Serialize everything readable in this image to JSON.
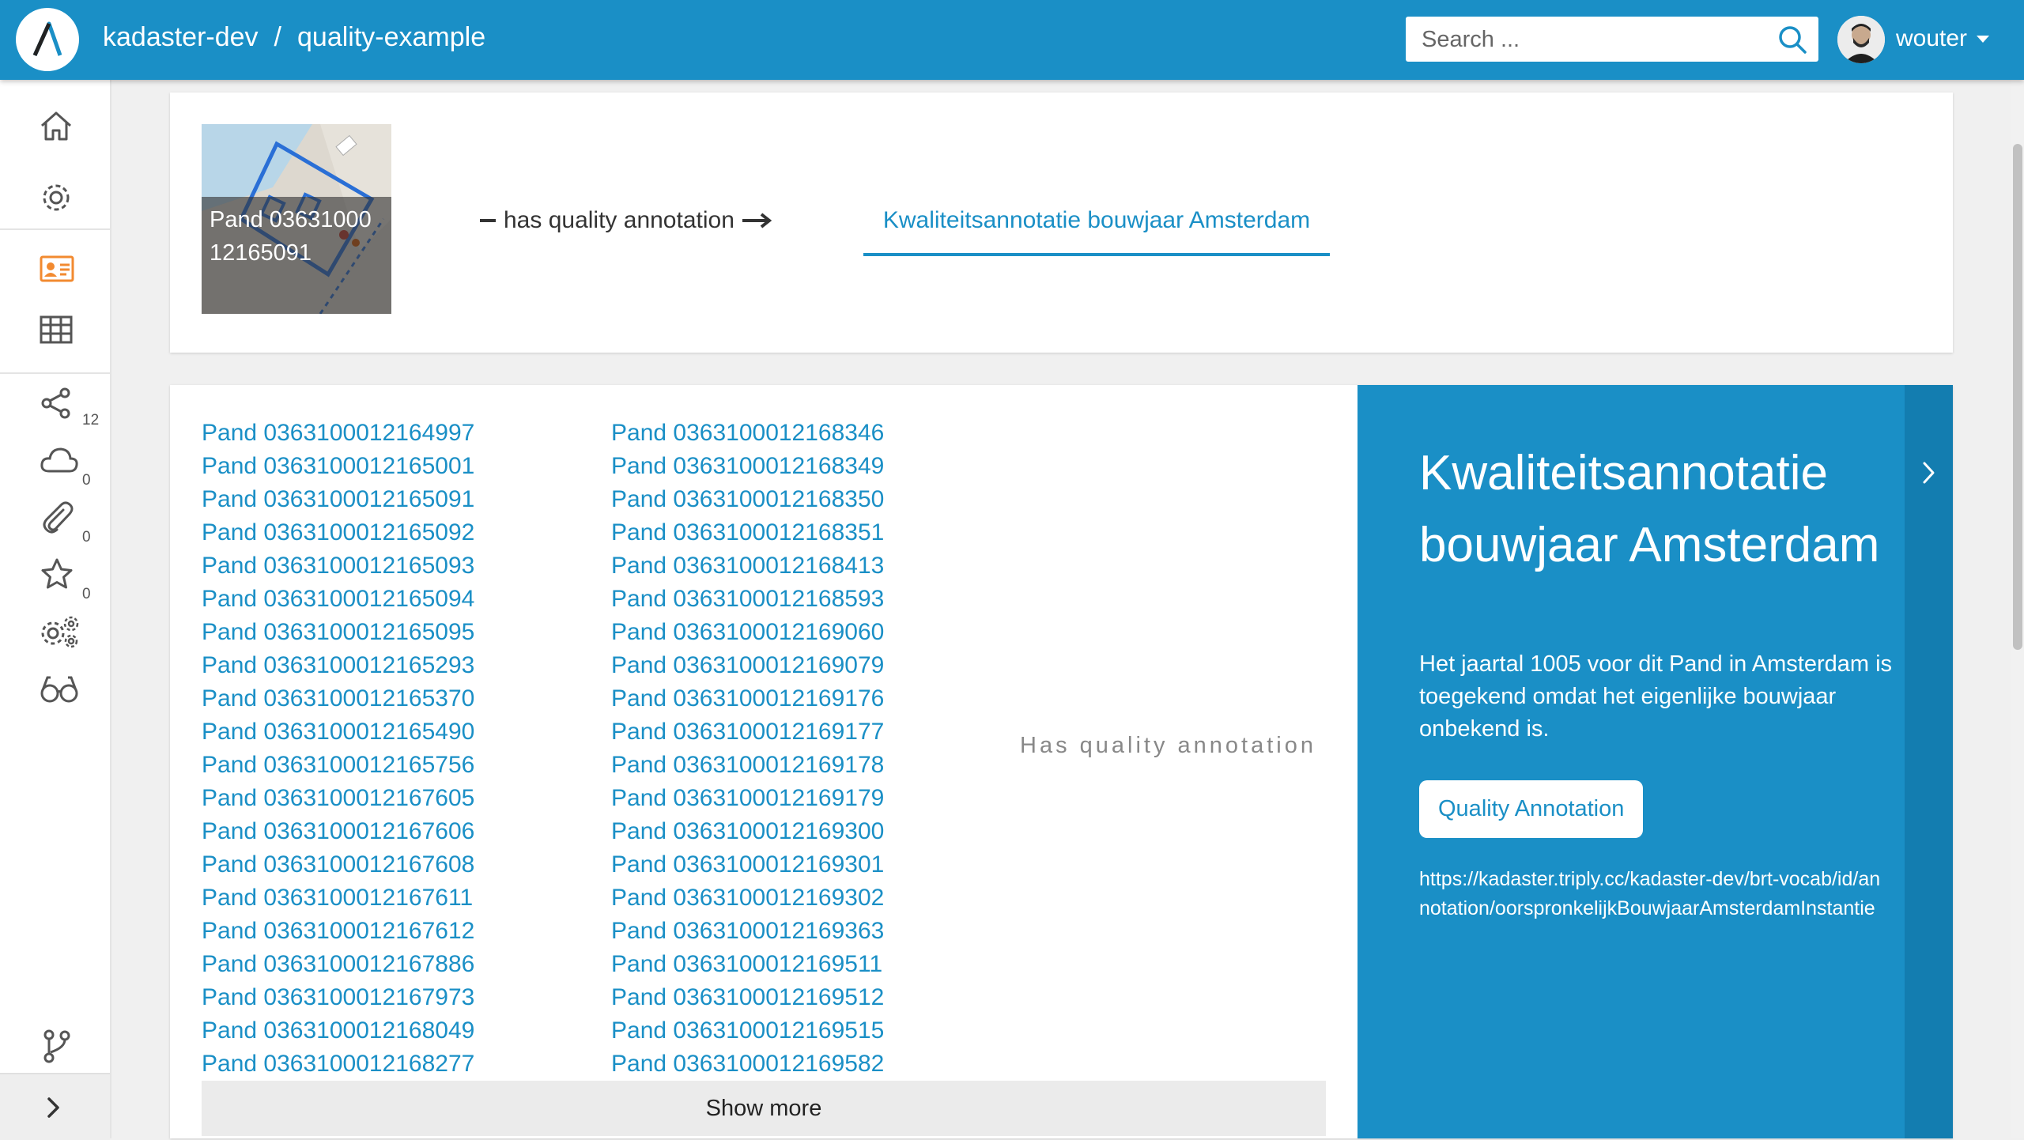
{
  "header": {
    "org": "kadaster-dev",
    "separator": "/",
    "dataset": "quality-example",
    "search_placeholder": "Search ...",
    "user": "wouter",
    "logo_icon": "triply-logo-icon",
    "search_icon": "search-icon",
    "accent": "#1a8fc6"
  },
  "sidebar": {
    "items": [
      {
        "name": "home-icon"
      },
      {
        "name": "gear-icon"
      },
      {
        "name": "id-card-icon",
        "active": true,
        "color": "#f28a30"
      },
      {
        "name": "table-icon"
      },
      {
        "name": "share-icon",
        "count": "12"
      },
      {
        "name": "cloud-icon",
        "count": "0"
      },
      {
        "name": "paperclip-icon",
        "count": "0"
      },
      {
        "name": "star-icon",
        "count": "0"
      },
      {
        "name": "gears-icon"
      },
      {
        "name": "glasses-icon"
      },
      {
        "name": "git-branch-icon"
      },
      {
        "name": "chevron-right-icon"
      }
    ]
  },
  "subject": {
    "label": "Pand 0363100012165091",
    "relation": "has quality annotation",
    "tab": "Kwaliteitsannotatie bouwjaar Amsterdam"
  },
  "list": {
    "col1": [
      "Pand 0363100012164997",
      "Pand 0363100012165001",
      "Pand 0363100012165091",
      "Pand 0363100012165092",
      "Pand 0363100012165093",
      "Pand 0363100012165094",
      "Pand 0363100012165095",
      "Pand 0363100012165293",
      "Pand 0363100012165370",
      "Pand 0363100012165490",
      "Pand 0363100012165756",
      "Pand 0363100012167605",
      "Pand 0363100012167606",
      "Pand 0363100012167608",
      "Pand 0363100012167611",
      "Pand 0363100012167612",
      "Pand 0363100012167886",
      "Pand 0363100012167973",
      "Pand 0363100012168049",
      "Pand 0363100012168277"
    ],
    "col2": [
      "Pand 0363100012168346",
      "Pand 0363100012168349",
      "Pand 0363100012168350",
      "Pand 0363100012168351",
      "Pand 0363100012168413",
      "Pand 0363100012168593",
      "Pand 0363100012169060",
      "Pand 0363100012169079",
      "Pand 0363100012169176",
      "Pand 0363100012169177",
      "Pand 0363100012169178",
      "Pand 0363100012169179",
      "Pand 0363100012169300",
      "Pand 0363100012169301",
      "Pand 0363100012169302",
      "Pand 0363100012169363",
      "Pand 0363100012169511",
      "Pand 0363100012169512",
      "Pand 0363100012169515",
      "Pand 0363100012169582"
    ],
    "relation_label": "Has quality annotation",
    "show_more": "Show more"
  },
  "panel": {
    "title": "Kwaliteitsannotatie bouwjaar Amsterdam",
    "description": "Het jaartal 1005 voor dit Pand in Amsterdam is toegekend omdat het eigenlijke bouwjaar onbekend is.",
    "type_button": "Quality Annotation",
    "uri": "https://kadaster.triply.cc/kadaster-dev/brt-vocab/id/annotation/oorspronkelijkBouwjaarAmsterdamInstantie"
  }
}
